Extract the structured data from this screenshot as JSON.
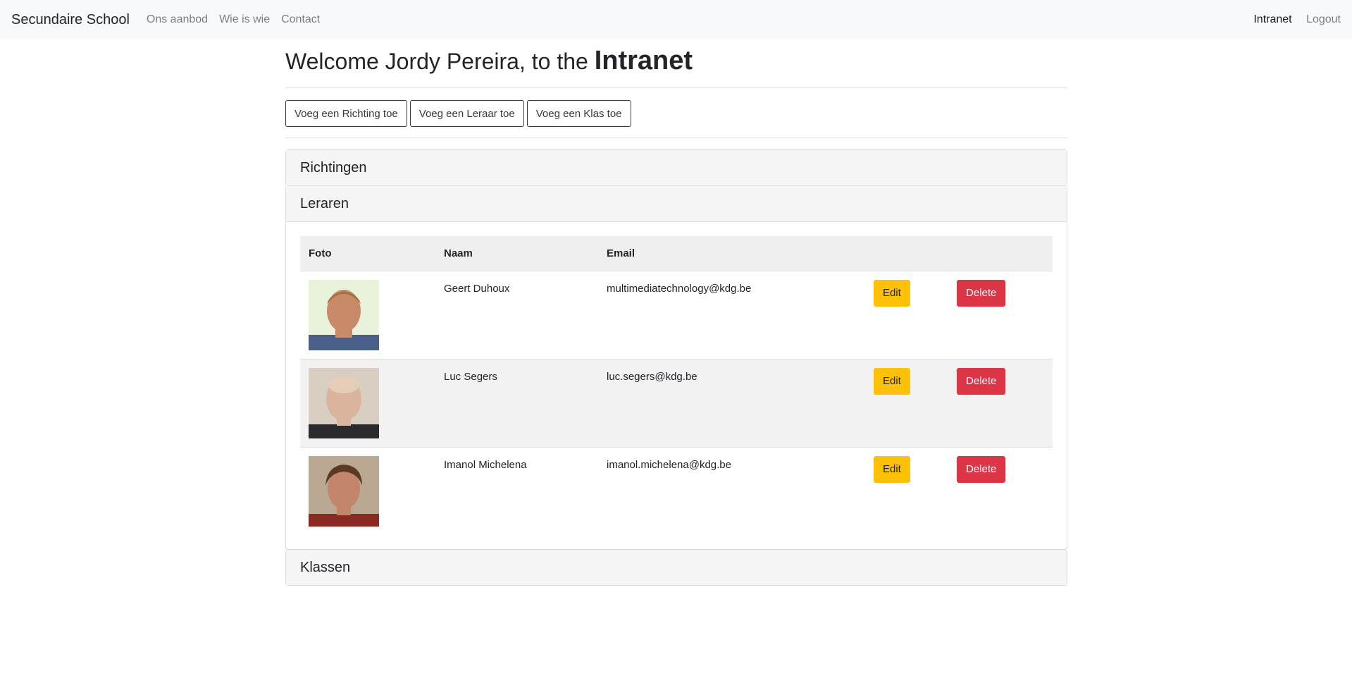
{
  "nav": {
    "brand": "Secundaire School",
    "links": [
      "Ons aanbod",
      "Wie is wie",
      "Contact"
    ],
    "right_links": [
      "Intranet",
      "Logout"
    ]
  },
  "welcome": {
    "prefix": "Welcome Jordy Pereira, to the ",
    "emphasis": "Intranet"
  },
  "actions": [
    "Voeg een Richting toe",
    "Voeg een Leraar toe",
    "Voeg een Klas toe"
  ],
  "sections": {
    "richtingen": "Richtingen",
    "leraren": "Leraren",
    "klassen": "Klassen"
  },
  "table": {
    "headers": [
      "Foto",
      "Naam",
      "Email"
    ],
    "edit_label": "Edit",
    "delete_label": "Delete",
    "rows": [
      {
        "name": "Geert Duhoux",
        "email": "multimediatechnology@kdg.be"
      },
      {
        "name": "Luc Segers",
        "email": "luc.segers@kdg.be"
      },
      {
        "name": "Imanol Michelena",
        "email": "imanol.michelena@kdg.be"
      }
    ]
  },
  "colors": {
    "edit": "#ffc107",
    "delete": "#dc3545",
    "navbar_bg": "#f8f9fa"
  }
}
